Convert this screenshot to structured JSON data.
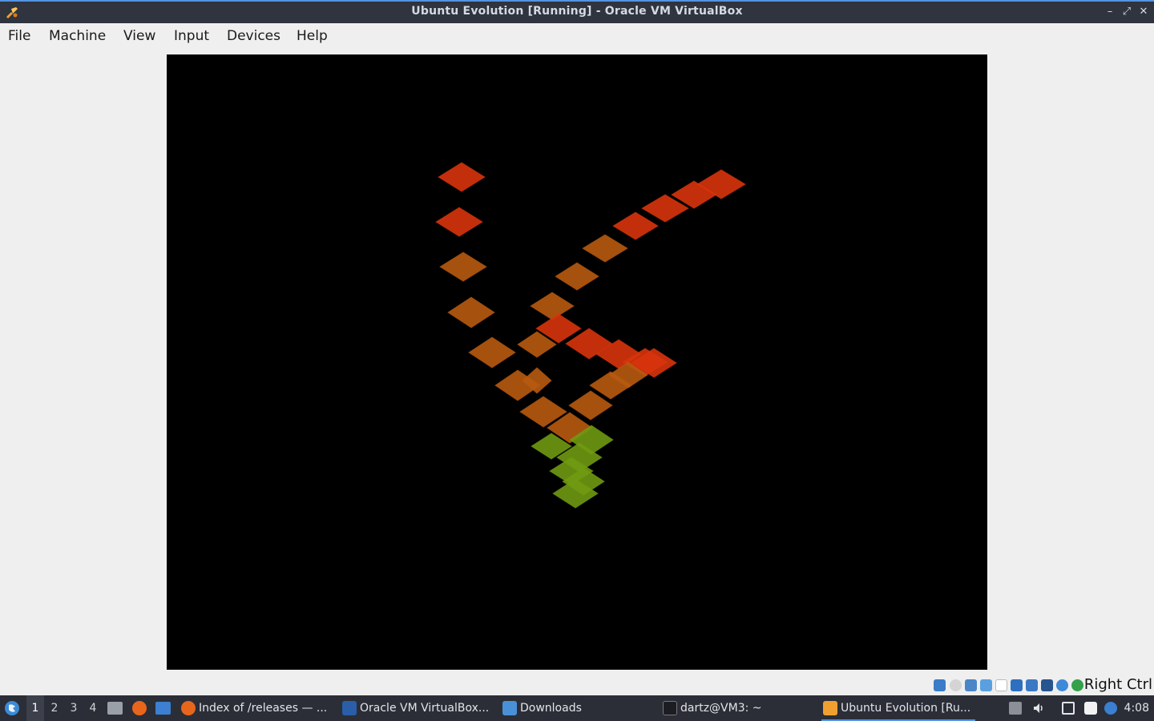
{
  "window": {
    "title": "Ubuntu Evolution [Running] - Oracle VM VirtualBox",
    "controls": {
      "minimize": "–",
      "maximize": "⤢",
      "close": "✕"
    }
  },
  "menubar": {
    "items": [
      "File",
      "Machine",
      "View",
      "Input",
      "Devices",
      "Help"
    ]
  },
  "vm_display": {
    "background": "#000000",
    "tile_colors": {
      "top": "#d8340c",
      "mid": "#b85a10",
      "bottom": "#6f9a12"
    }
  },
  "statusbar": {
    "icons": [
      "hard-disk-icon",
      "optical-drive-icon",
      "audio-icon",
      "network-icon",
      "usb-icon",
      "shared-folders-icon",
      "display-icon",
      "video-capture-icon",
      "cpu-icon",
      "mouse-integration-icon",
      "keyboard-icon"
    ],
    "host_key": "Right Ctrl"
  },
  "taskbar": {
    "workspaces": [
      "1",
      "2",
      "3",
      "4"
    ],
    "active_workspace": "1",
    "tasks": [
      {
        "label": "Index of /releases — ...",
        "icon": "firefox-icon"
      },
      {
        "label": "Oracle VM VirtualBox...",
        "icon": "virtualbox-manager-icon"
      },
      {
        "label": "Downloads",
        "icon": "folder-icon"
      },
      {
        "label": "dartz@VM3: ~",
        "icon": "terminal-icon"
      },
      {
        "label": "Ubuntu Evolution [Ru...",
        "icon": "virtualbox-vm-icon"
      }
    ],
    "clock": "4:08"
  }
}
